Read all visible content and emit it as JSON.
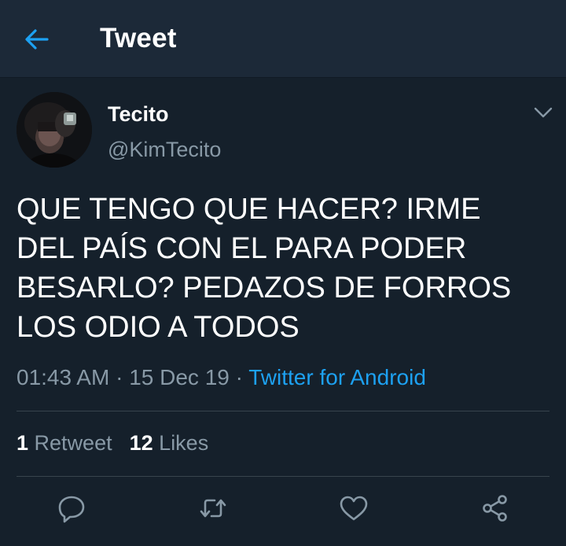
{
  "header": {
    "title": "Tweet",
    "back_icon": "arrow-left-icon"
  },
  "tweet": {
    "author": {
      "display_name": "Tecito",
      "handle": "@KimTecito"
    },
    "text": "QUE TENGO QUE HACER? IRME\nDEL PAÍS CON EL PARA PODER\nBESARLO? PEDAZOS DE FORROS\nLOS ODIO A TODOS",
    "time": "01:43 AM",
    "sep1": "·",
    "date": "15 Dec 19",
    "sep2": "·",
    "source": "Twitter for Android",
    "stats": {
      "retweets": "1",
      "retweets_label": "Retweet",
      "likes": "12",
      "likes_label": "Likes"
    }
  },
  "actions": [
    "reply-icon",
    "retweet-icon",
    "like-icon",
    "share-icon"
  ],
  "colors": {
    "background": "#15202b",
    "header": "#1c2938",
    "accent": "#1da1f2",
    "muted": "#8899a6",
    "divider": "#38444d"
  }
}
